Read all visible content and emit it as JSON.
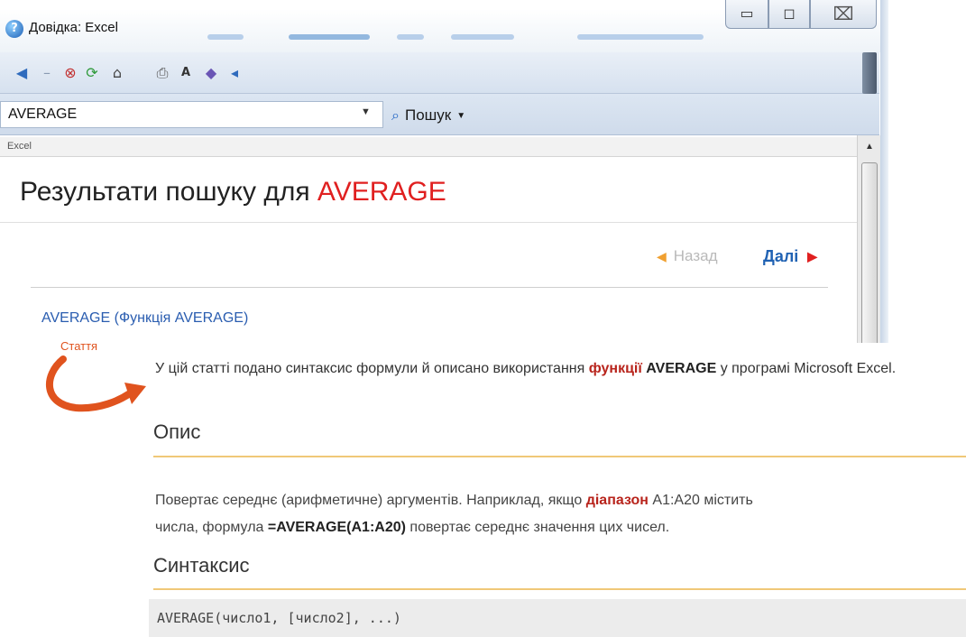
{
  "window": {
    "title": "Довідка: Excel",
    "controls": {
      "minimize": "▭",
      "maximize": "◻",
      "close": "⌧"
    }
  },
  "toolbar": {
    "icons": [
      "back-icon",
      "forward-icon",
      "stop-icon",
      "refresh-icon",
      "home-icon",
      "print-icon",
      "text-size-icon",
      "toc-icon",
      "pin-icon"
    ]
  },
  "search": {
    "value": "AVERAGE",
    "button_label": "Пошук"
  },
  "breadcrumb": "Excel",
  "results": {
    "heading_prefix": "Результати пошуку для ",
    "heading_term": "AVERAGE",
    "nav_prev": "Назад",
    "nav_next": "Далі",
    "first_result": "AVERAGE (Функція AVERAGE)"
  },
  "callout": {
    "label": "Стаття"
  },
  "article": {
    "summary_1": "У цій статті подано синтаксис формули й описано використання ",
    "summary_kw": "функції",
    "summary_bold": " AVERAGE",
    "summary_2": " у програмі Microsoft Excel.",
    "section_description": "Опис",
    "desc_1": "Повертає середнє (арифметичне) аргументів. Наприклад, якщо ",
    "desc_kw": "діапазон",
    "desc_2": " A1:A20 містить",
    "desc_3": "числа, формула ",
    "desc_bold": "=AVERAGE(A1:A20)",
    "desc_4": " повертає середнє значення цих чисел.",
    "section_syntax": "Синтаксис",
    "syntax_code": "AVERAGE(число1, [число2], ...)"
  },
  "colors": {
    "accent_red": "#e02020",
    "link_blue": "#2a5db0",
    "callout_orange": "#e0531e",
    "section_rule": "#f0c878"
  }
}
